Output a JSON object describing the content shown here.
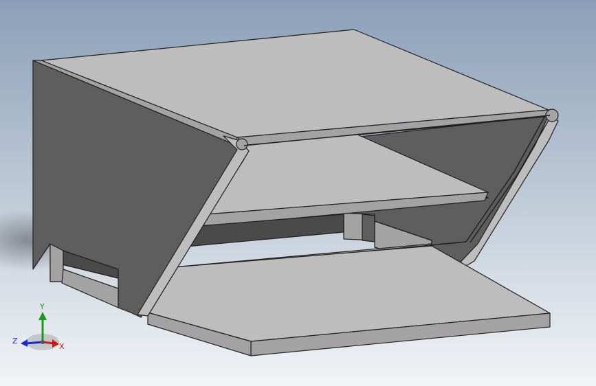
{
  "colors": {
    "background_top": "#8a9fb8",
    "background_bottom": "#f2f4f6",
    "face_light": "#bdbdbd",
    "face_mid": "#a3a3a3",
    "face_dark": "#5e5e5e",
    "face_darkest": "#4a4a4a",
    "edge": "#1e1e1e",
    "axis_x": "#d01818",
    "axis_y": "#1a9a1a",
    "axis_z": "#1a2ad0"
  },
  "triad": {
    "x_label": "X",
    "y_label": "Y",
    "z_label": "Z"
  }
}
